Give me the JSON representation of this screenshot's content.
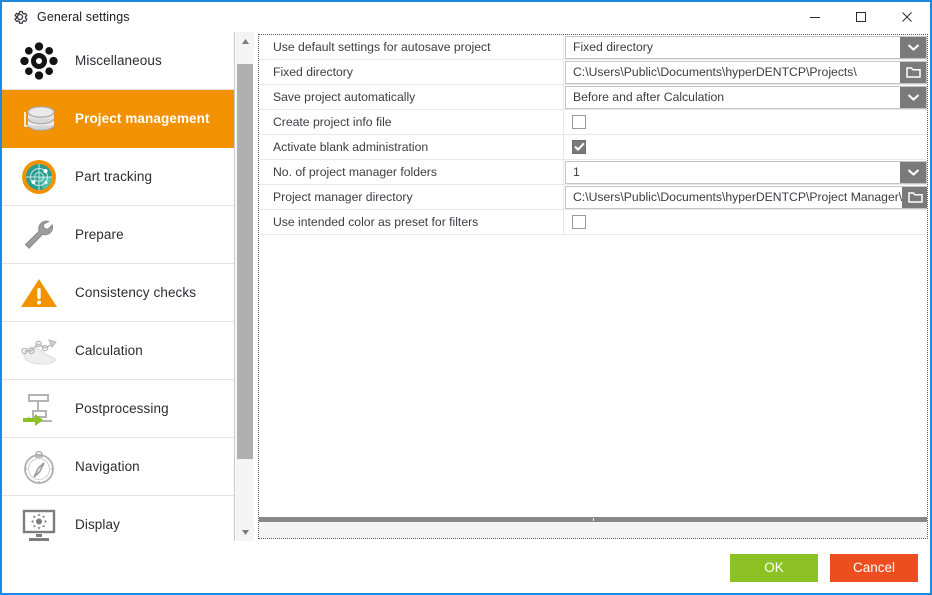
{
  "window": {
    "title": "General settings",
    "title_icon": "gear-icon",
    "controls": {
      "minimize": "minimize-icon",
      "maximize": "maximize-icon",
      "close": "close-icon"
    }
  },
  "colors": {
    "accent_orange": "#f39200",
    "window_border_blue": "#1b8ae0",
    "ok_green": "#8cc224",
    "cancel_red": "#ec4e20",
    "control_gray": "#7a7a7a"
  },
  "sidebar": {
    "scroll": {
      "up_icon": "scroll-up-arrow-icon",
      "down_icon": "scroll-down-arrow-icon"
    },
    "items": [
      {
        "label": "Miscellaneous",
        "icon": "gear-icon",
        "selected": false
      },
      {
        "label": "Project management",
        "icon": "database-icon",
        "selected": true
      },
      {
        "label": "Part tracking",
        "icon": "radar-icon",
        "selected": false
      },
      {
        "label": "Prepare",
        "icon": "wrench-icon",
        "selected": false
      },
      {
        "label": "Consistency checks",
        "icon": "warning-triangle-icon",
        "selected": false
      },
      {
        "label": "Calculation",
        "icon": "toolpath-icon",
        "selected": false
      },
      {
        "label": "Postprocessing",
        "icon": "machine-export-icon",
        "selected": false
      },
      {
        "label": "Navigation",
        "icon": "compass-icon",
        "selected": false
      },
      {
        "label": "Display",
        "icon": "monitor-gear-icon",
        "selected": false
      }
    ]
  },
  "settings": {
    "rows": [
      {
        "label": "Use default settings for autosave project",
        "type": "dropdown",
        "value": "Fixed directory",
        "button_icon": "chevron-down-icon"
      },
      {
        "label": "Fixed directory",
        "type": "path",
        "value": "C:\\Users\\Public\\Documents\\hyperDENTCP\\Projects\\",
        "button_icon": "folder-icon"
      },
      {
        "label": "Save project automatically",
        "type": "dropdown",
        "value": "Before and after Calculation",
        "button_icon": "chevron-down-icon"
      },
      {
        "label": "Create project info file",
        "type": "checkbox",
        "checked": false
      },
      {
        "label": "Activate blank administration",
        "type": "checkbox",
        "checked": true
      },
      {
        "label": "No. of project manager folders",
        "type": "dropdown",
        "value": "1",
        "button_icon": "chevron-down-icon"
      },
      {
        "label": "Project manager directory",
        "type": "path",
        "value": "C:\\Users\\Public\\Documents\\hyperDENTCP\\Project Manager\\",
        "button_icon": "folder-icon"
      },
      {
        "label": "Use intended color as preset for filters",
        "type": "checkbox",
        "checked": false
      }
    ],
    "description_text": ""
  },
  "footer": {
    "ok_label": "OK",
    "cancel_label": "Cancel"
  }
}
